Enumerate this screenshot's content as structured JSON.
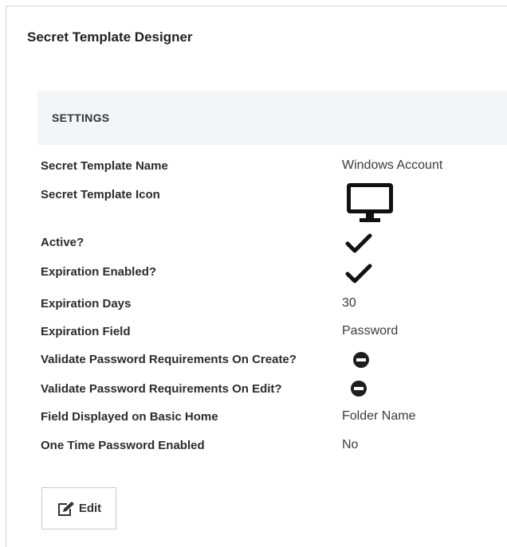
{
  "page": {
    "title": "Secret Template Designer"
  },
  "settings": {
    "section_title": "SETTINGS",
    "rows": [
      {
        "label": "Secret Template Name",
        "value": "Windows Account"
      },
      {
        "label": "Secret Template Icon",
        "icon": "monitor-icon"
      },
      {
        "label": "Active?",
        "icon": "checkmark-icon"
      },
      {
        "label": "Expiration Enabled?",
        "icon": "checkmark-icon"
      },
      {
        "label": "Expiration Days",
        "value": "30"
      },
      {
        "label": "Expiration Field",
        "value": "Password"
      },
      {
        "label": "Validate Password Requirements On Create?",
        "icon": "minus-circle-icon"
      },
      {
        "label": "Validate Password Requirements On Edit?",
        "icon": "minus-circle-icon"
      },
      {
        "label": "Field Displayed on Basic Home",
        "value": "Folder Name"
      },
      {
        "label": "One Time Password Enabled",
        "value": "No"
      }
    ]
  },
  "actions": {
    "edit_label": "Edit",
    "edit_icon": "edit-icon"
  }
}
